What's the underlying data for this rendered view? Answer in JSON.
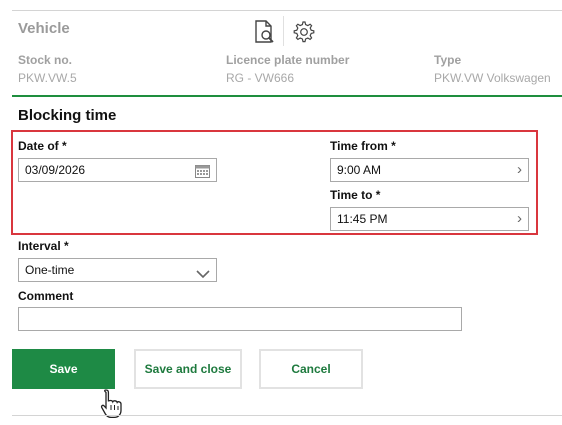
{
  "vehicle": {
    "title": "Vehicle",
    "stock_label": "Stock no.",
    "stock_value": "PKW.VW.5",
    "plate_label": "Licence plate number",
    "plate_value": "RG - VW666",
    "type_label": "Type",
    "type_value": "PKW.VW Volkswagen"
  },
  "form": {
    "section_title": "Blocking time",
    "date_label": "Date of *",
    "date_value": "03/09/2026",
    "time_from_label": "Time from *",
    "time_from_value": "9:00 AM",
    "time_to_label": "Time to *",
    "time_to_value": "11:45 PM",
    "interval_label": "Interval *",
    "interval_value": "One-time",
    "comment_label": "Comment",
    "comment_value": ""
  },
  "buttons": {
    "save": "Save",
    "save_close": "Save and close",
    "cancel": "Cancel"
  },
  "icons": {
    "document_search": "document-search-icon",
    "settings": "gear-icon",
    "calendar": "calendar-icon",
    "chevron": "chevron-right-icon",
    "dropdown": "chevron-down-icon",
    "cursor": "hand-pointer-cursor"
  },
  "colors": {
    "accent_green": "#1e8a45",
    "highlight_red": "#d9363e"
  }
}
